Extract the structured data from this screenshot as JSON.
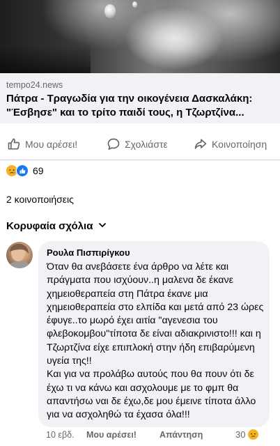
{
  "link_preview": {
    "domain": "tempo24.news",
    "title": "Πάτρα - Τραγωδία για την οικογένεια Δασκαλάκη: \"Έσβησε\" και το τρίτο παιδί τους, η Τζωρτζίνα..."
  },
  "actions": {
    "like_label": "Μου αρέσει!",
    "comment_label": "Σχολιάστε",
    "share_label": "Κοινοποίηση"
  },
  "reactions": {
    "count": "69",
    "icons": [
      "sad-emoji",
      "like-emoji"
    ]
  },
  "shares_text": "2 κοινοποιήσεις",
  "comments_header": {
    "label": "Κορυφαία σχόλια",
    "icon": "chevron-down-icon"
  },
  "comment": {
    "author": "Ρουλα Πισπιρίγκου",
    "text": "Όταν θα ανεβάσετε ένα άρθρο να λέτε και πράγματα που ισχύουν..η μαλενα δε έκανε χημειοθεραπεία στη Πάτρα έκανε μια χημειοθεραπεία στο ελπίδα και μετά από 23 ώρες έφυγε..το μωρό έχει αιτία \"αγενεσια του φλεβοκομβου\"τίποτα δε είναι αδιακρινιστο!!! και η Τζωρτζίνα είχε επιπλοκή στην ήδη επιβαρύμενη υγεία της!!\nΚαι για να προλάβω αυτούς που θα πουν ότι δε έχω τι να κάνω και ασχολουμε με το φμπ θα απαντήσω ναι δε έχω,δε μου έμεινε τίποτα άλλο για να ασχοληθώ τα έχασα όλα!!!",
    "time": "10 εβδ.",
    "like_label": "Μου αρέσει!",
    "reply_label": "Απάντηση",
    "reaction_count": "30"
  },
  "colors": {
    "muted": "#65676b",
    "bubble": "#f0f2f5",
    "like_blue": "#1877f2",
    "sad_yellow": "#f7b125"
  }
}
